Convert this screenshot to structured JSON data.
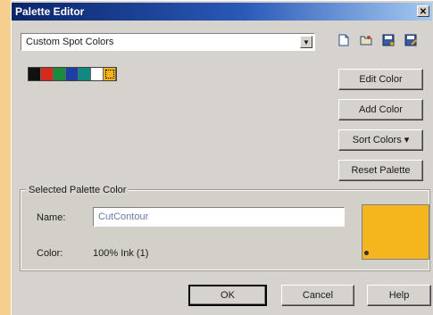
{
  "window": {
    "title": "Palette Editor",
    "close_glyph": "✕"
  },
  "palette_select": {
    "value": "Custom Spot Colors",
    "arrow": "▼"
  },
  "toolbar_icons": [
    "new-palette-icon",
    "open-palette-icon",
    "save-palette-icon",
    "save-as-palette-icon"
  ],
  "swatches": [
    {
      "color": "#111111"
    },
    {
      "color": "#d62a1c"
    },
    {
      "color": "#1a8a3c"
    },
    {
      "color": "#1d3fa6"
    },
    {
      "color": "#0e8a82"
    },
    {
      "color": "#ffffff"
    },
    {
      "color": "#f3b21a"
    }
  ],
  "buttons": {
    "edit_color": "Edit Color",
    "add_color": "Add Color",
    "sort_colors": "Sort Colors  ▾",
    "reset_palette": "Reset Palette",
    "ok": "OK",
    "cancel": "Cancel",
    "help": "Help"
  },
  "selected": {
    "group_title": "Selected Palette Color",
    "name_label": "Name:",
    "name_value": "CutContour",
    "color_label": "Color:",
    "color_value": "100% Ink (1)",
    "preview_color": "#f5b51c"
  }
}
